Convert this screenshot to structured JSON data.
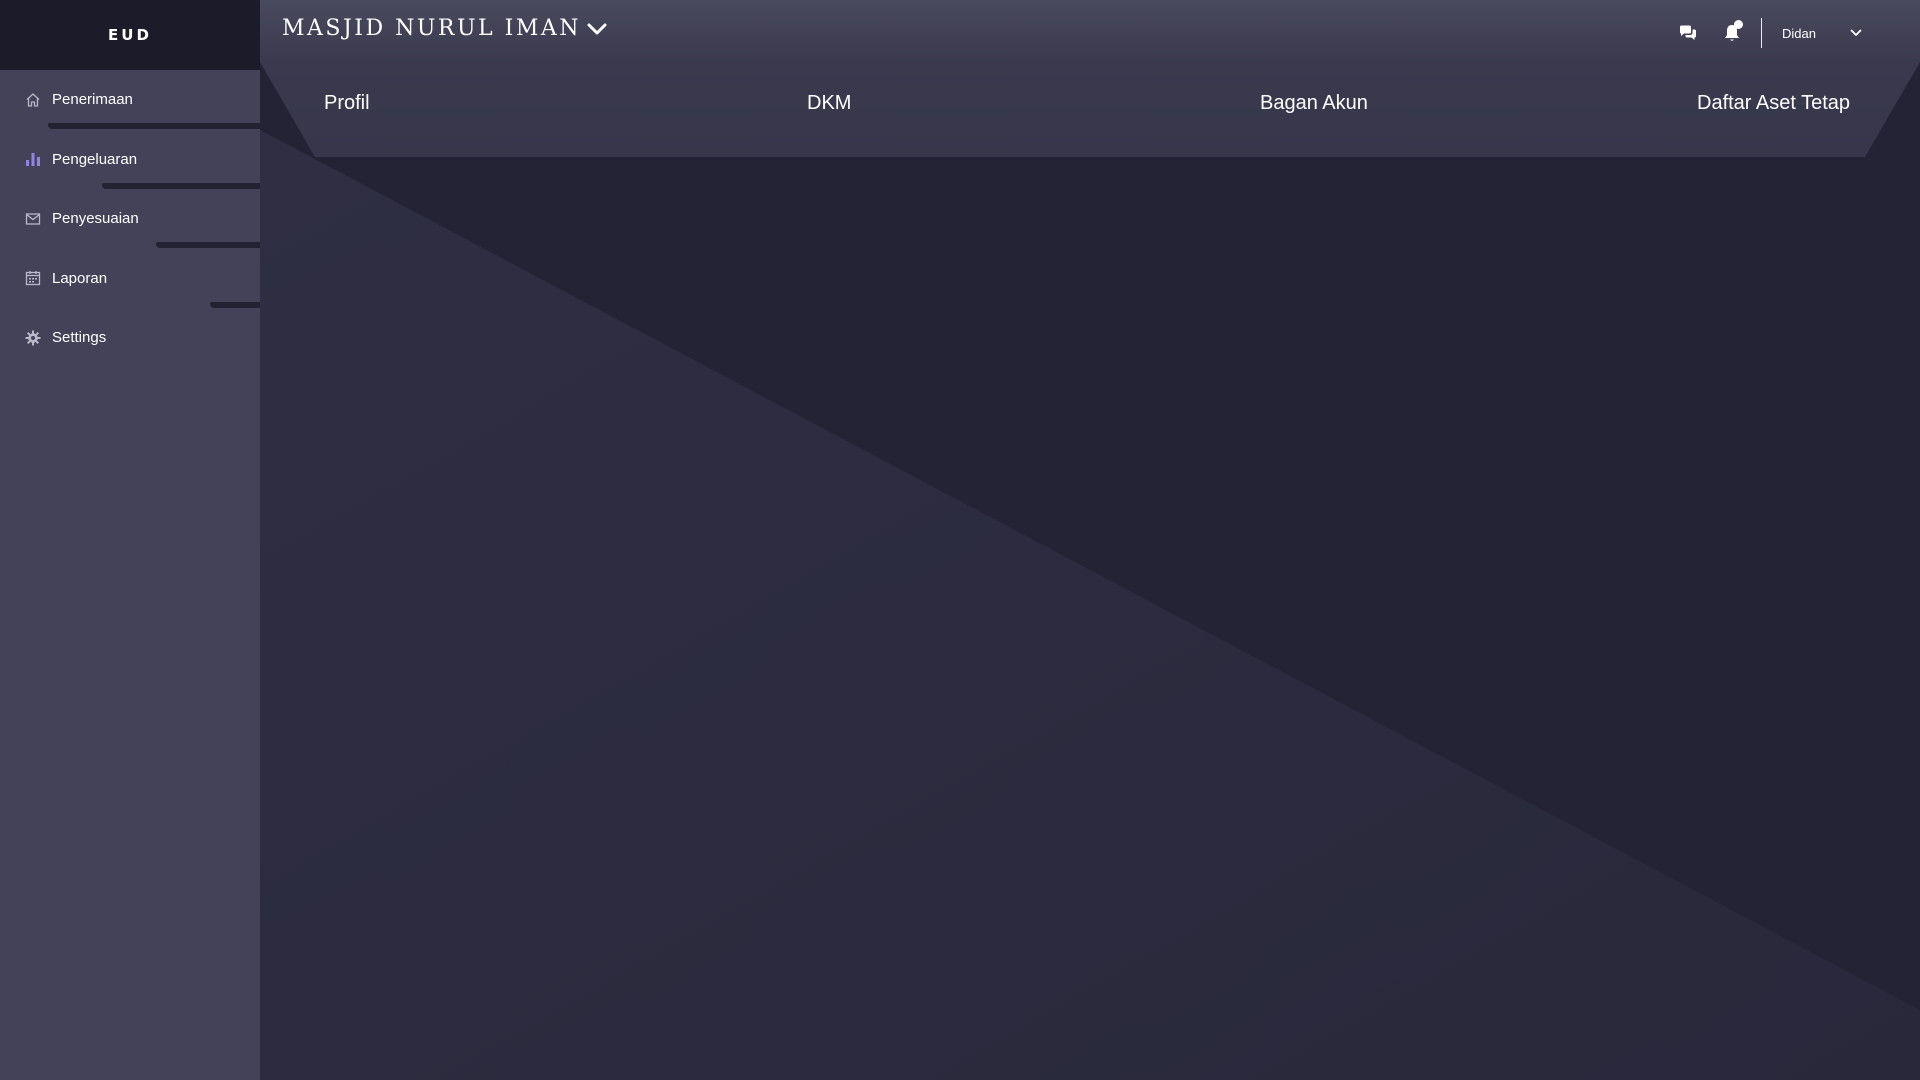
{
  "sidebar": {
    "brand": "EUD",
    "items": [
      {
        "label": "Penerimaan",
        "icon": "home-icon"
      },
      {
        "label": "Pengeluaran",
        "icon": "bar-chart-icon"
      },
      {
        "label": "Penyesuaian",
        "icon": "mail-icon"
      },
      {
        "label": "Laporan",
        "icon": "calendar-icon"
      },
      {
        "label": "Settings",
        "icon": "gear-icon"
      }
    ]
  },
  "header": {
    "title": "MASJID NURUL IMAN",
    "user_name": "Didan"
  },
  "tabs": [
    {
      "label": "Profil"
    },
    {
      "label": "DKM"
    },
    {
      "label": "Bagan Akun"
    },
    {
      "label": "Daftar Aset Tetap"
    }
  ],
  "colors": {
    "sidebar_bg": "#434259",
    "brand_bg": "#1c1b29",
    "main_bg": "#262538",
    "accent_icon": "#8f84e0"
  }
}
